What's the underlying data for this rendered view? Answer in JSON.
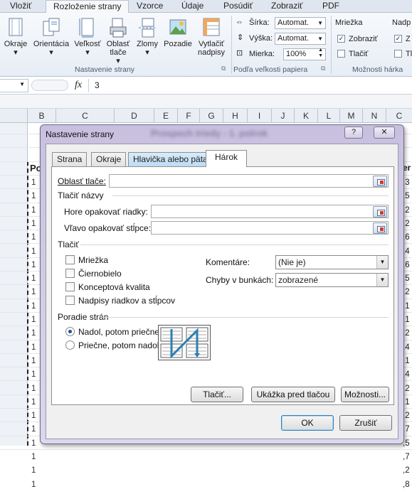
{
  "ribbon": {
    "tabs": [
      "Vložiť",
      "Rozloženie strany",
      "Vzorce",
      "Údaje",
      "Posúdiť",
      "Zobraziť",
      "PDF"
    ],
    "buttons": [
      "Okraje",
      "Orientácia",
      "Veľkosť",
      "Oblasť tlače",
      "Zlomy",
      "Pozadie",
      "Vytlačiť nadpisy"
    ],
    "group_page_setup": "Nastavenie strany",
    "width_label": "Šírka:",
    "width_value": "Automat.",
    "height_label": "Výška:",
    "height_value": "Automat.",
    "scale_label": "Mierka:",
    "scale_value": "100%",
    "group_scale": "Podľa veľkosti papiera",
    "gridlines_title": "Mriežka",
    "view_label": "Zobraziť",
    "print_label": "Tlačiť",
    "group_options": "Možnosti hárka",
    "headings_title": "Nadp",
    "headings_view": "Z",
    "headings_print": "Tl"
  },
  "formula_bar": {
    "fx": "fx",
    "value": "3"
  },
  "columns": [
    "B",
    "C",
    "D",
    "E",
    "F",
    "G",
    "H",
    "I",
    "J",
    "K",
    "L",
    "M",
    "N",
    "C"
  ],
  "sheet": {
    "left_fragment": "Po",
    "right_fragment": "er",
    "row_digit": "1",
    "right_values": [
      ",3",
      ",5",
      ",2",
      ",2",
      ",6",
      ",4",
      ",6",
      ",5",
      ",2",
      ",1",
      ",1",
      ",2",
      ",4",
      ",1",
      ",4",
      ",2",
      ",1",
      ",2",
      ",7",
      ",5",
      ",7",
      ",2",
      ",8"
    ]
  },
  "dialog": {
    "title": "Nastavenie strany",
    "blurred_title": "Prospech triedy - 1. polrok",
    "tabs": [
      "Strana",
      "Okraje",
      "Hlavička alebo päta",
      "Hárok"
    ],
    "print_area_label": "Oblasť tlače:",
    "print_titles_section": "Tlačiť názvy",
    "rows_repeat_label": "Hore opakovať riadky:",
    "cols_repeat_label": "Vľavo opakovať stĺpce:",
    "print_section": "Tlačiť",
    "checkboxes": [
      "Mriežka",
      "Čiernobielo",
      "Konceptová kvalita",
      "Nadpisy riadkov a stĺpcov"
    ],
    "comments_label": "Komentáre:",
    "comments_value": "(Nie je)",
    "errors_label": "Chyby v bunkách:",
    "errors_value": "zobrazené",
    "page_order_section": "Poradie strán",
    "order_down": "Nadol, potom priečne",
    "order_over": "Priečne, potom nadol",
    "print_button": "Tlačiť...",
    "preview_button": "Ukážka pred tlačou",
    "options_button": "Možnosti...",
    "ok_button": "OK",
    "cancel_button": "Zrušiť",
    "help_button": "?",
    "close_button": "✕"
  }
}
